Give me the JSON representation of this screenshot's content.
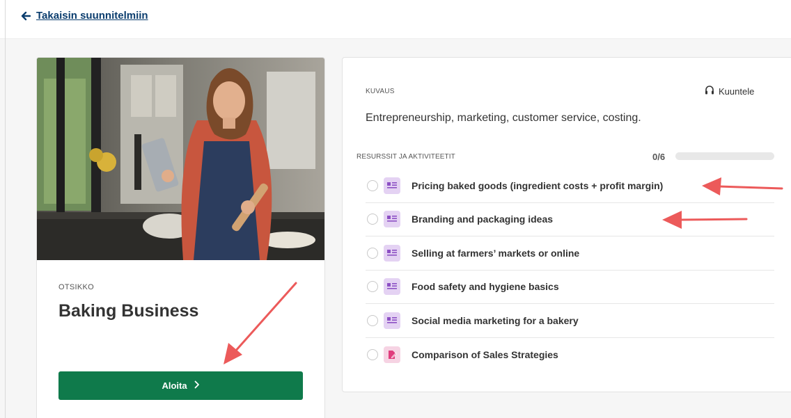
{
  "nav": {
    "back_label": "Takaisin suunnitelmiin"
  },
  "course": {
    "title_label": "OTSIKKO",
    "title": "Baking Business",
    "start_label": "Aloita"
  },
  "details": {
    "description_label": "KUVAUS",
    "listen_label": "Kuuntele",
    "description": "Entrepreneurship, marketing, customer service, costing.",
    "resources_label": "RESURSSIT JA AKTIVITEETIT",
    "progress_text": "0/6",
    "progress_fraction": 0,
    "items": [
      {
        "label": "Pricing baked goods (ingredient costs + profit margin)",
        "icon": "document-icon"
      },
      {
        "label": "Branding and packaging ideas",
        "icon": "document-icon"
      },
      {
        "label": "Selling at farmers’ markets or online",
        "icon": "document-icon"
      },
      {
        "label": "Food safety and hygiene basics",
        "icon": "document-icon"
      },
      {
        "label": "Social media marketing for a bakery",
        "icon": "document-icon"
      },
      {
        "label": "Comparison of Sales Strategies",
        "icon": "assignment-icon"
      }
    ]
  },
  "colors": {
    "primary_green": "#0f7a4b",
    "link_blue": "#0b3d6e",
    "annotation_red": "#ec5a5a",
    "doc_icon_bg": "#e4d2f3",
    "task_icon_bg": "#f6d3e3"
  }
}
